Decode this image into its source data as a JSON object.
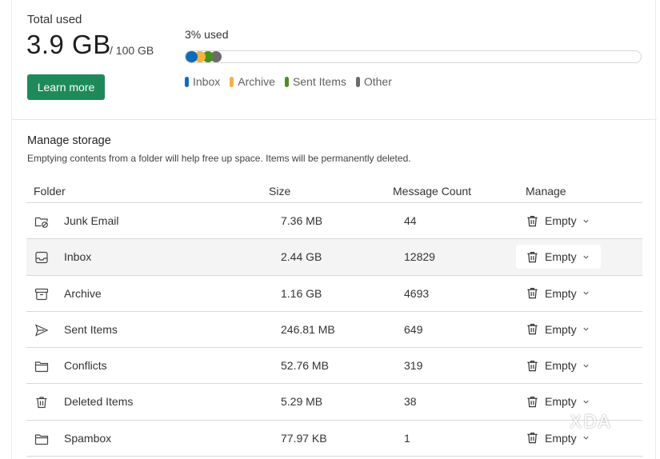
{
  "usage": {
    "total_label": "Total used",
    "total_value": "3.9 GB",
    "total_max": "/ 100 GB",
    "learn_more_label": "Learn more",
    "percent_label": "3% used",
    "colors": {
      "inbox": "#0f6cbd",
      "archive": "#f2b344",
      "sent": "#4b8f1d",
      "other": "#6b6b6b",
      "accent": "#1e8a5a"
    },
    "legend": [
      {
        "label": "Inbox",
        "color": "#0f6cbd"
      },
      {
        "label": "Archive",
        "color": "#f2b344"
      },
      {
        "label": "Sent Items",
        "color": "#4b8f1d"
      },
      {
        "label": "Other",
        "color": "#6b6b6b"
      }
    ]
  },
  "manage": {
    "title": "Manage storage",
    "description": "Emptying contents from a folder will help free up space. Items will be permanently deleted.",
    "columns": {
      "folder": "Folder",
      "size": "Size",
      "count": "Message Count",
      "manage": "Manage"
    },
    "empty_label": "Empty",
    "rows": [
      {
        "icon": "junk-icon",
        "name": "Junk Email",
        "size": "7.36 MB",
        "count": "44"
      },
      {
        "icon": "inbox-icon",
        "name": "Inbox",
        "size": "2.44 GB",
        "count": "12829"
      },
      {
        "icon": "archive-icon",
        "name": "Archive",
        "size": "1.16 GB",
        "count": "4693"
      },
      {
        "icon": "send-icon",
        "name": "Sent Items",
        "size": "246.81 MB",
        "count": "649"
      },
      {
        "icon": "folder-icon",
        "name": "Conflicts",
        "size": "52.76 MB",
        "count": "319"
      },
      {
        "icon": "trash-icon",
        "name": "Deleted Items",
        "size": "5.29 MB",
        "count": "38"
      },
      {
        "icon": "folder-icon",
        "name": "Spambox",
        "size": "77.97 KB",
        "count": "1"
      }
    ]
  },
  "watermark": "XDA"
}
